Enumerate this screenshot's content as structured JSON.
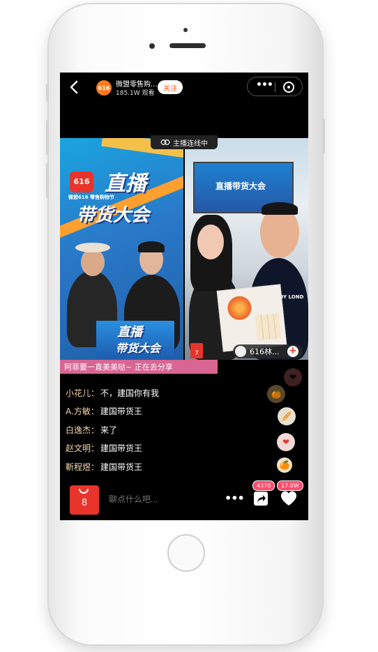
{
  "header": {
    "back_icon": "back-arrow-icon",
    "avatar_text": "616",
    "title": "微盟零售购...",
    "viewers": "185.1W 观看",
    "follow_label": "关注",
    "more_icon": "more-dots-icon",
    "close_icon": "close-circle-icon"
  },
  "video": {
    "link_status": "主播连线中",
    "link_icon": "link-icon",
    "promo_text": "阿菲要一直美美哒~  正在去分享",
    "left_poster_line1": "直播",
    "left_poster_line2": "带货大会",
    "left_poster_small": "微盟616 零售购物节",
    "left_badge": "616",
    "desk_poster_line1": "直播",
    "desk_poster_line2": "带货大会",
    "right_screen_text": "直播带货大会",
    "shirt_text": "BOY LOND",
    "small_bag_count": "7",
    "guest_name": "616林...",
    "guest_add": "+"
  },
  "comments": [
    {
      "user": "小花儿：",
      "text": "不，建国你有我"
    },
    {
      "user": "A.方敏：",
      "text": "建国带货王"
    },
    {
      "user": "白逸杰：",
      "text": "来了"
    },
    {
      "user": "赵文明：",
      "text": "建国带货王"
    },
    {
      "user": "靳程煜：",
      "text": "建国带货王"
    }
  ],
  "bottom": {
    "bag_count": "8",
    "input_placeholder": "聊点什么吧...",
    "more_icon": "more-dots-icon",
    "share_count": "4370",
    "like_count": "17.0W",
    "share_icon": "share-icon",
    "like_icon": "heart-icon"
  },
  "colors": {
    "accent_red": "#e8342a",
    "follow_orange": "#ff5a1a",
    "promo_pink": "#ec6ea0",
    "comment_user": "#f7d6a8"
  }
}
